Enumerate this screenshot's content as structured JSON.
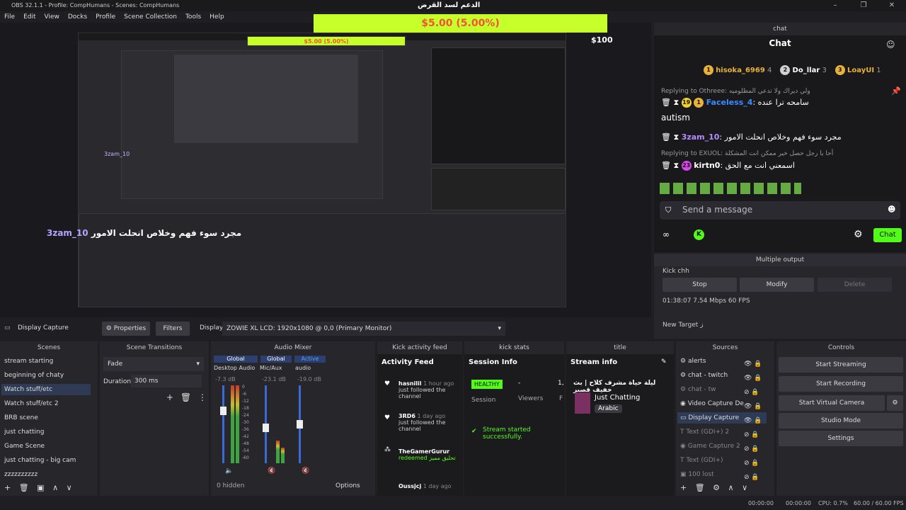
{
  "window": {
    "title": "OBS 32.1.1 - Profile: CompHumans - Scenes: CompHumans"
  },
  "menu": [
    "File",
    "Edit",
    "View",
    "Docks",
    "Profile",
    "Scene Collection",
    "Tools",
    "Help"
  ],
  "overlay": {
    "goal_title": "الدعم لسد القرض",
    "goal_amount": "$5.00 (5.00%)",
    "goal_target": "$100",
    "stream_text_left": "3zam_10",
    "stream_text_arabic": "مجرد سوء فهم وخلاص انحلت الامور"
  },
  "chat": {
    "dock_title": "chat",
    "header": "Chat",
    "leaders": [
      {
        "rank": "1",
        "name": "hisoka_6969",
        "score": "4",
        "color": "#e8b23a"
      },
      {
        "rank": "2",
        "name": "Do_llar",
        "score": "3",
        "color": "#cfcfcf"
      },
      {
        "rank": "3",
        "name": "LoayUI",
        "score": "1",
        "color": "#e8b23a"
      }
    ],
    "messages": [
      {
        "reply": "Replying to Othreee: ولي ديراك ولا تدعي المظلوميه",
        "user": "Faceless_4",
        "user_color": "#3a8cff",
        "text": "سامحه ترا عنده",
        "text2": "autism"
      },
      {
        "reply": "",
        "user": "3zam_10",
        "user_color": "#b48cff",
        "text": "مجرد سوء فهم وخلاص انحلت الامور",
        "text2": ""
      },
      {
        "reply": "Replying to EXUOL: أحا يا رجل حصل خير ممكن انت المشكلة",
        "user": "kirtn0",
        "user_color": "#ffffff",
        "text": "اسمعني انت مع الحق",
        "text2": ""
      }
    ],
    "input_placeholder": "Send a message",
    "chat_button": "Chat"
  },
  "multi_output": {
    "title": "Multiple output",
    "target1": "Kick chh",
    "stop": "Stop",
    "modify": "Modify",
    "delete": "Delete",
    "stats": "01:38:07  7.54 Mbps  60 FPS",
    "target2": "New Target ز"
  },
  "toolbar": {
    "source_name": "Display Capture",
    "properties": "Properties",
    "filters": "Filters",
    "display_label": "Display",
    "display_value": "ZOWIE XL LCD: 1920x1080 @ 0,0 (Primary Monitor)"
  },
  "scenes": {
    "title": "Scenes",
    "items": [
      "stream starting",
      "beginning of chaty",
      "Watch stuff/etc",
      "Watch stuff/etc 2",
      "BRB scene",
      "just chatting",
      "Game Scene",
      "just chatting - big cam",
      "zzzzzzzzzz"
    ]
  },
  "transitions": {
    "title": "Scene Transitions",
    "value": "Fade",
    "duration_label": "Duration",
    "duration": "300 ms"
  },
  "mixer": {
    "title": "Audio Mixer",
    "tabs": [
      "Global",
      "Global",
      "Active"
    ],
    "channels": [
      {
        "name": "Desktop Audio",
        "db": "-7.3 dB"
      },
      {
        "name": "Mic/Aux",
        "db": "-23.1 dB"
      },
      {
        "name": "audio",
        "db": "-19.0 dB"
      }
    ],
    "scale": [
      "0",
      "-6",
      "-12",
      "-18",
      "-24",
      "-30",
      "-36",
      "-42",
      "-48",
      "-54",
      "-60"
    ],
    "hidden": "0 hidden",
    "options": "Options"
  },
  "activity": {
    "title": "Kick activity feed",
    "header": "Activity Feed",
    "items": [
      {
        "user": "hasnilil",
        "time": "1 hour ago",
        "text": "just followed the channel"
      },
      {
        "user": "3RD6",
        "time": "1 day ago",
        "text": "just followed the channel"
      },
      {
        "user": "TheGamerGurur",
        "time": "",
        "text": "redeemed تحليق مميز"
      },
      {
        "user": "Oussjcj",
        "time": "1 day ago",
        "text": ""
      }
    ]
  },
  "kickstats": {
    "title": "kick stats",
    "header": "Session Info",
    "status": "HEALTHY",
    "status_label": "Session",
    "dash": "-",
    "viewers": "Viewers",
    "one": "1,",
    "f": "F",
    "started": "Stream started successfully."
  },
  "streaminfo": {
    "title": "title",
    "header": "Stream info",
    "stream_title": "ليلة حياة مشرف كلاح | بث خفيف قصير",
    "category": "Just Chatting",
    "language": "Arabic"
  },
  "sources": {
    "title": "Sources",
    "items": [
      {
        "name": "alerts",
        "dim": false
      },
      {
        "name": "chat - twitch",
        "dim": false
      },
      {
        "name": "chat - tw",
        "dim": true
      },
      {
        "name": "Video Capture De",
        "dim": false
      },
      {
        "name": "Display Capture",
        "dim": false
      },
      {
        "name": "Text (GDI+) 2",
        "dim": true
      },
      {
        "name": "Game Capture 2",
        "dim": true
      },
      {
        "name": "Text (GDI+)",
        "dim": true
      },
      {
        "name": "100 lost",
        "dim": true
      }
    ]
  },
  "controls": {
    "title": "Controls",
    "buttons": [
      "Start Streaming",
      "Start Recording",
      "Start Virtual Camera",
      "Studio Mode",
      "Settings"
    ]
  },
  "statusbar": {
    "time1": "00:00:00",
    "time2": "00:00:00",
    "cpu": "CPU: 0.7%",
    "fps": "60.00 / 60.00 FPS"
  },
  "colors": {
    "accent": "#53fc18",
    "donation_bar": "#c6ff2a",
    "selection": "#2f3a55"
  }
}
